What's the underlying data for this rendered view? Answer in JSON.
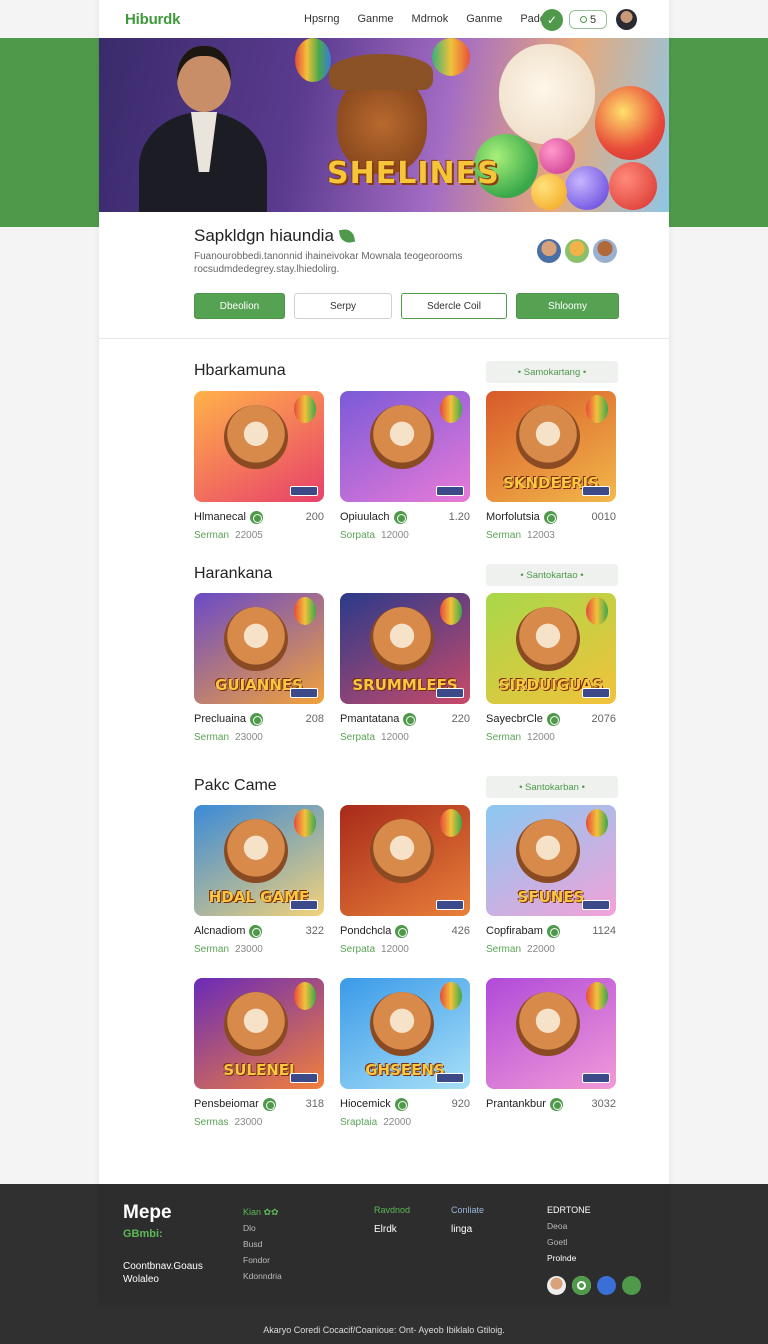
{
  "header": {
    "logo": "Hiburdk",
    "nav": [
      "Hpsrng",
      "Ganme",
      "Mdrnok",
      "Ganme",
      "Padde"
    ],
    "check_icon": "check-icon",
    "pill_value": "5"
  },
  "hero": {
    "title": "SHELINES"
  },
  "intro": {
    "title": "Sapkldgn hiaundia",
    "description": "Fuanourobbedi.tanonnid ihaineivokar Mownala teogeorooms rocsudmdedegrey.stay.lhiedolirg.",
    "buttons": [
      "Dbeolion",
      "Serpy",
      "Sdercle Coil",
      "Shloomy"
    ]
  },
  "sections": [
    {
      "title": "Hbarkamuna",
      "see_all": "• Samokartang •",
      "cards": [
        {
          "name": "Hlmanecal",
          "num": "200",
          "label": "Serman",
          "value": "22005"
        },
        {
          "name": "Opiuulach",
          "num": "1.20",
          "label": "Sorpata",
          "value": "12000"
        },
        {
          "name": "Morfolutsia",
          "num": "0010",
          "label": "Serman",
          "value": "12003"
        }
      ]
    },
    {
      "title": "Harankana",
      "see_all": "• Santokartao •",
      "cards": [
        {
          "name": "Precluaina",
          "num": "208",
          "label": "Serman",
          "value": "23000"
        },
        {
          "name": "Pmantatana",
          "num": "220",
          "label": "Serpata",
          "value": "12000"
        },
        {
          "name": "SayecbrCle",
          "num": "2076",
          "label": "Serman",
          "value": "12000"
        }
      ]
    },
    {
      "title": "Pakc Came",
      "see_all": "• Santokarban •",
      "cards": [
        {
          "name": "Alcnadiom",
          "num": "322",
          "label": "Serman",
          "value": "23000"
        },
        {
          "name": "Pondchcla",
          "num": "426",
          "label": "Serpata",
          "value": "12000"
        },
        {
          "name": "Copfirabam",
          "num": "1124",
          "label": "Serman",
          "value": "22000"
        },
        {
          "name": "Pensbeiomar",
          "num": "318",
          "label": "Sermas",
          "value": "23000"
        },
        {
          "name": "Hiocemick",
          "num": "920",
          "label": "Sraptaia",
          "value": "22000"
        },
        {
          "name": "Prantankbur",
          "num": "3032",
          "label": "",
          "value": ""
        }
      ]
    }
  ],
  "thumb_words": [
    "",
    "",
    "SKNDEERIS",
    "GUIANNES",
    "SRUMMLEES",
    "SIRDUIGUAS",
    "HDAL GAME",
    "",
    "SFUNES",
    "SULENEI",
    "GHSEENS",
    ""
  ],
  "footer": {
    "brand": "Mepe",
    "brand_sub": "GBmbi:",
    "tagline": "Coontbnav.Goaus Wolaleo",
    "col1": {
      "head": "Kian ✿✿",
      "items": [
        "Dlo",
        "Busd",
        "Fondor",
        "Kdonndria"
      ]
    },
    "col2": {
      "head": "Ravdnod",
      "items": [
        "Elrdk"
      ]
    },
    "col3": {
      "head": "Conliate",
      "items": [
        "linga"
      ]
    },
    "col4": {
      "head": "EDRTONE",
      "items": [
        "Deoa",
        "Goetl",
        "Prolnde"
      ]
    }
  },
  "legal": "Akaryo Coredi Cocacif/Coanioue: Ont- Ayeob Ibiklalo Gtiloig.",
  "colors": {
    "accent": "#4e9a4a",
    "footer": "#2c2d2c"
  }
}
